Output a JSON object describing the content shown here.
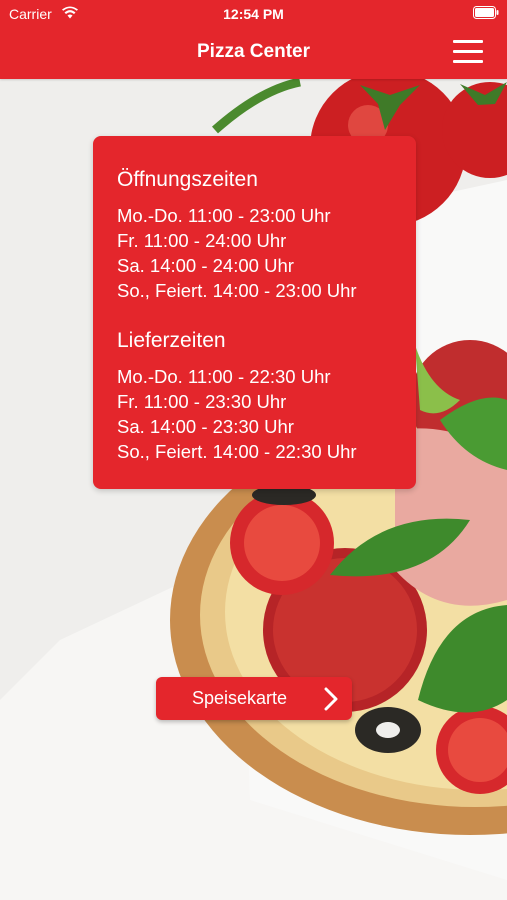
{
  "status_bar": {
    "carrier": "Carrier",
    "time": "12:54 PM"
  },
  "nav": {
    "title": "Pizza Center",
    "menu_icon": "hamburger-menu-icon"
  },
  "hours_card": {
    "opening_title": "Öffnungszeiten",
    "opening_lines": [
      "Mo.-Do. 11:00 - 23:00 Uhr",
      "Fr. 11:00 - 24:00 Uhr",
      "Sa. 14:00 - 24:00 Uhr",
      "So., Feiert. 14:00 - 23:00 Uhr"
    ],
    "delivery_title": "Lieferzeiten",
    "delivery_lines": [
      "Mo.-Do. 11:00 - 22:30 Uhr",
      "Fr. 11:00 - 23:30 Uhr",
      "Sa. 14:00 - 23:30 Uhr",
      "So., Feiert. 14:00 - 22:30 Uhr"
    ]
  },
  "menu_button": {
    "label": "Speisekarte",
    "icon": "chevron-right-icon"
  },
  "colors": {
    "brand_red": "#e4262c",
    "text": "#ffffff"
  }
}
